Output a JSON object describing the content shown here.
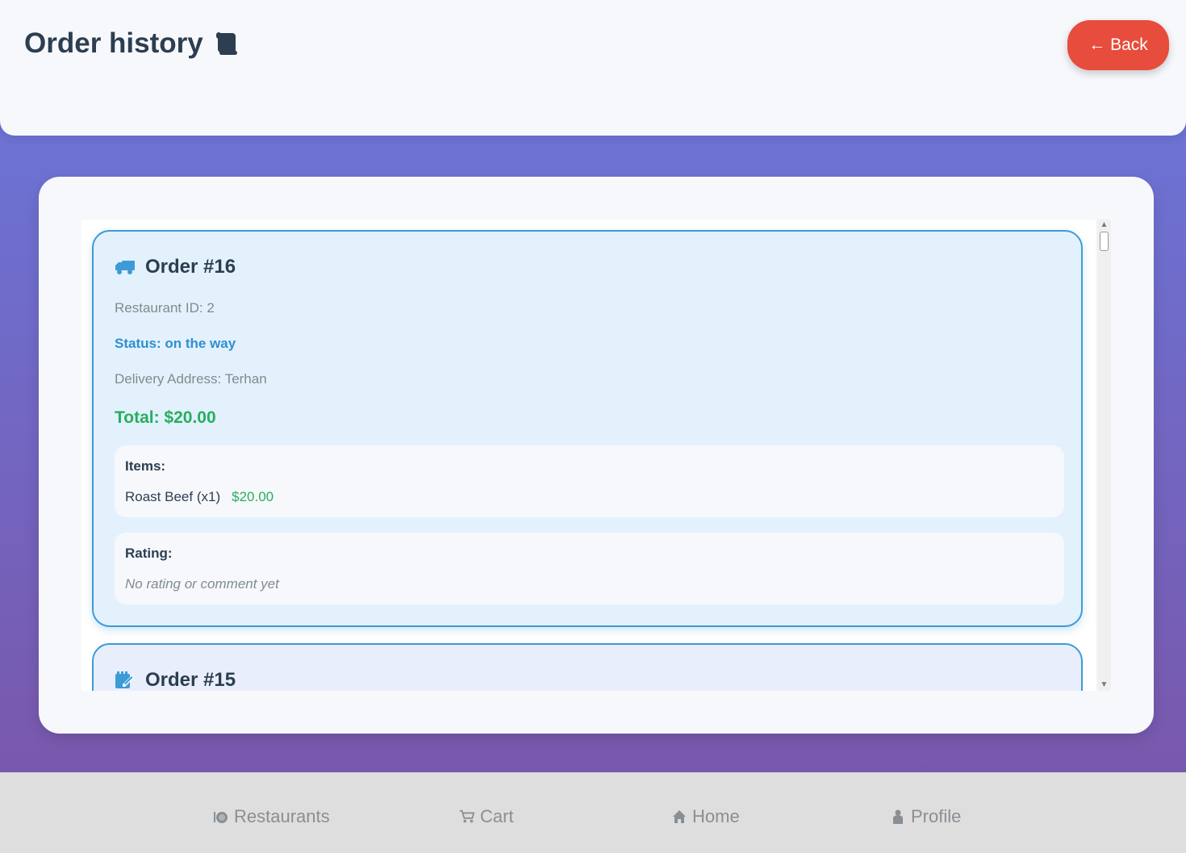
{
  "header": {
    "title": "Order history",
    "back_label": "← Back"
  },
  "orders": [
    {
      "title": "Order #16",
      "restaurant": "Restaurant ID: 2",
      "status": "Status: on the way",
      "address": "Delivery Address: Terhan",
      "total": "Total: $20.00",
      "items_label": "Items:",
      "items": [
        {
          "name": "Roast Beef (x1)",
          "price": "$20.00"
        }
      ],
      "rating_label": "Rating:",
      "rating_text": "No rating or comment yet"
    },
    {
      "title": "Order #15"
    }
  ],
  "nav": {
    "restaurants": "Restaurants",
    "cart": "Cart",
    "home": "Home",
    "profile": "Profile"
  },
  "colors": {
    "accent_red": "#e74c3c",
    "status_blue": "#2e8fd1",
    "price_green": "#27ae60",
    "card_border": "#3d9bd6"
  }
}
